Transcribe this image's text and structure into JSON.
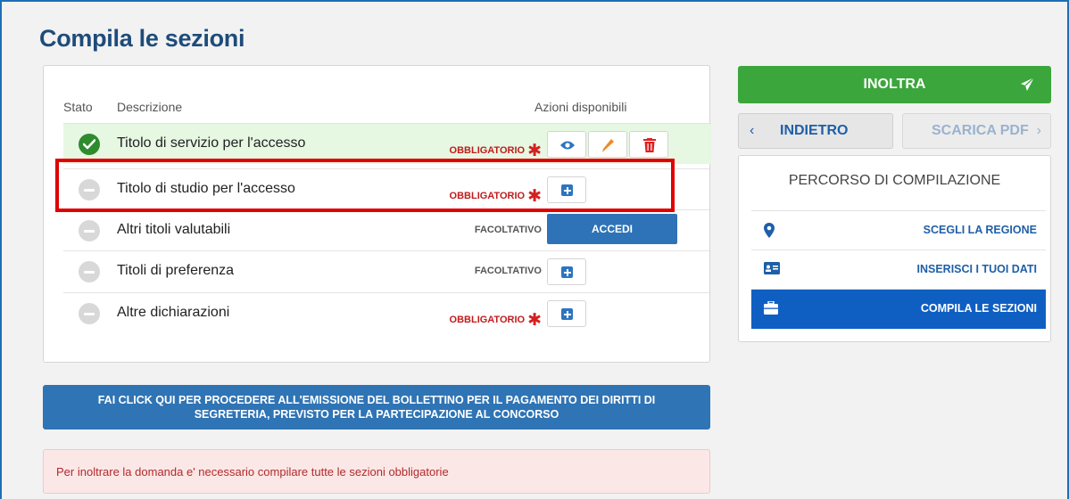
{
  "page": {
    "title": "Compila le sezioni"
  },
  "table": {
    "headers": {
      "stato": "Stato",
      "descrizione": "Descrizione",
      "azioni": "Azioni disponibili"
    },
    "rows": [
      {
        "status": "complete",
        "description": "Titolo di servizio per l'accesso",
        "requirement": "OBBLIGATORIO",
        "actions": [
          "view",
          "edit",
          "delete"
        ]
      },
      {
        "status": "empty",
        "description": "Titolo di studio per l'accesso",
        "requirement": "OBBLIGATORIO",
        "actions": [
          "add"
        ]
      },
      {
        "status": "empty",
        "description": "Altri titoli valutabili",
        "requirement": "FACOLTATIVO",
        "actions": [
          "accedi"
        ],
        "action_label": "ACCEDI"
      },
      {
        "status": "empty",
        "description": "Titoli di preferenza",
        "requirement": "FACOLTATIVO",
        "actions": [
          "add"
        ]
      },
      {
        "status": "empty",
        "description": "Altre dichiarazioni",
        "requirement": "OBBLIGATORIO",
        "actions": [
          "add"
        ]
      }
    ],
    "required_marker": "✱"
  },
  "bollettino": {
    "line1": "FAI CLICK QUI PER PROCEDERE ALL'EMISSIONE DEL BOLLETTINO PER IL PAGAMENTO DEI DIRITTI DI",
    "line2": "SEGRETERIA, PREVISTO PER LA PARTECIPAZIONE AL CONCORSO"
  },
  "alert": {
    "text": "Per inoltrare la domanda e' necessario compilare tutte le sezioni obbligatorie"
  },
  "sidebar": {
    "inoltra_label": "INOLTRA",
    "indietro_label": "INDIETRO",
    "scarica_label": "SCARICA PDF",
    "percorso_title": "PERCORSO DI COMPILAZIONE",
    "steps": [
      {
        "label": "SCEGLI LA REGIONE",
        "icon": "map-marker-icon",
        "active": false
      },
      {
        "label": "INSERISCI I TUOI DATI",
        "icon": "id-card-icon",
        "active": false
      },
      {
        "label": "COMPILA LE SEZIONI",
        "icon": "briefcase-icon",
        "active": true
      }
    ]
  },
  "colors": {
    "primary_blue": "#2e73b7",
    "success_green": "#3ba63b",
    "required_red": "#c01c1c",
    "title_blue": "#1e4c7a"
  }
}
